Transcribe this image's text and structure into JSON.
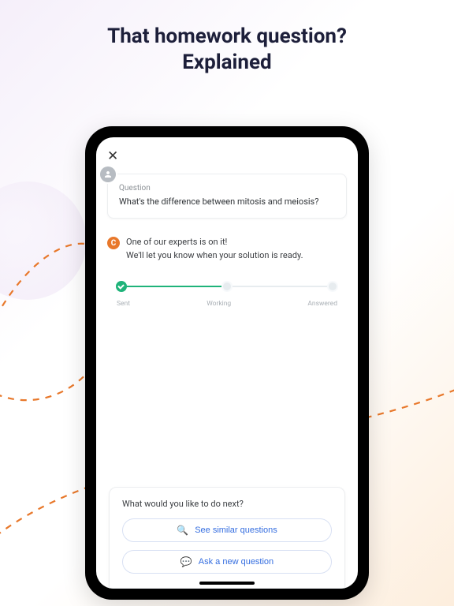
{
  "headline": {
    "line1": "That homework question?",
    "line2": "Explained"
  },
  "question": {
    "label": "Question",
    "text": "What's the difference between mitosis and meiosis?"
  },
  "expert": {
    "badge": "C",
    "line1": "One of our experts is on it!",
    "line2": "We'll let you know when your solution is ready."
  },
  "progress": {
    "stages": {
      "sent": "Sent",
      "working": "Working",
      "answered": "Answered"
    }
  },
  "next": {
    "title": "What would you like to do next?",
    "see_similar": "See similar questions",
    "ask_new": "Ask a new question"
  },
  "colors": {
    "accent_green": "#1fb37a",
    "accent_orange": "#e8782b",
    "link_blue": "#356ee0"
  }
}
